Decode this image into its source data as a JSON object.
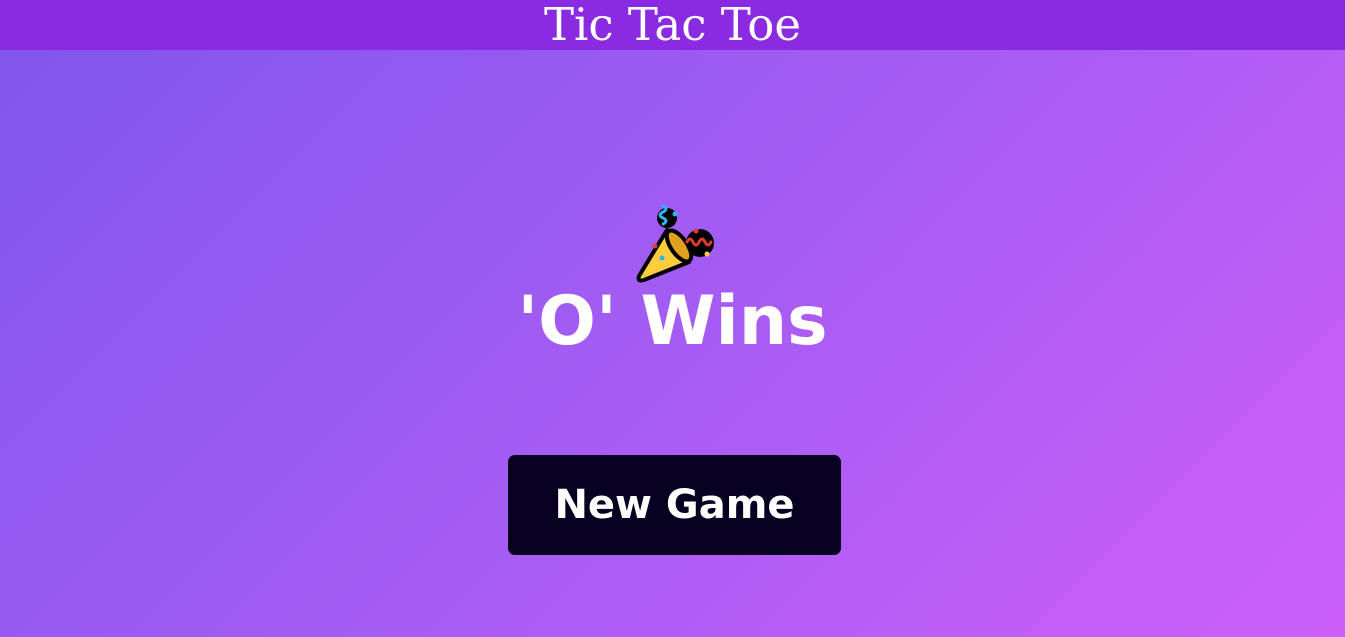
{
  "header": {
    "title": "Tic Tac Toe"
  },
  "result": {
    "icon": "party-popper-icon",
    "message": "'O' Wins"
  },
  "actions": {
    "new_game_label": "New Game"
  },
  "colors": {
    "header_bg": "#8a2be2",
    "background_gradient": [
      "#7f56ec",
      "#cd5ff9"
    ],
    "button_bg": "#070020",
    "text": "#ffffff"
  }
}
